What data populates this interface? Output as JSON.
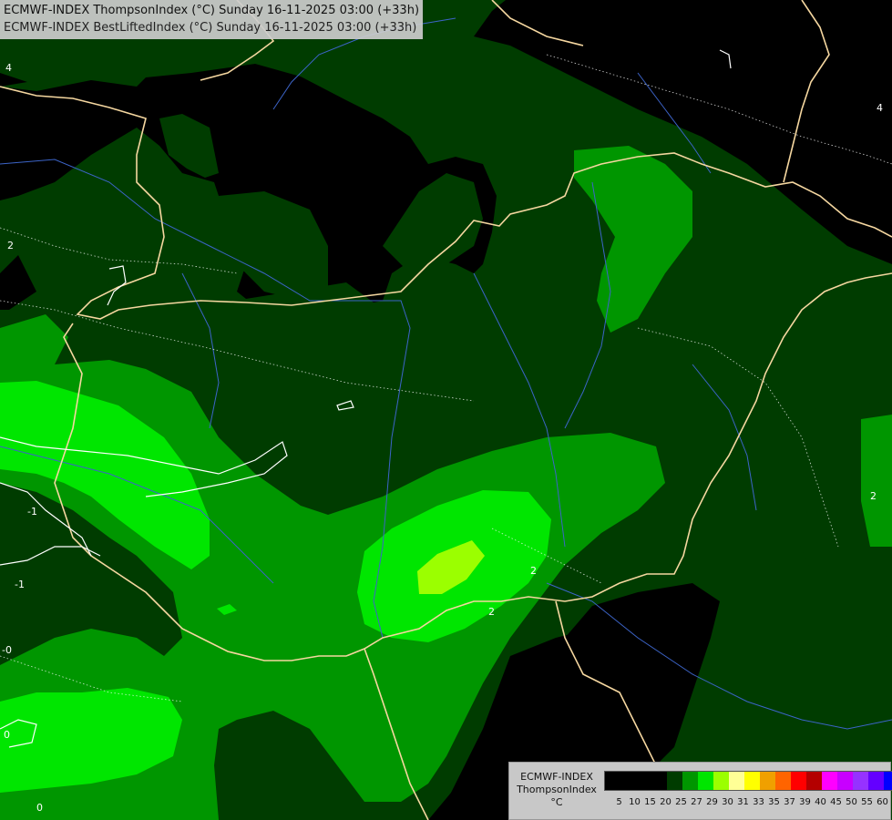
{
  "header": {
    "line1": "ECMWF-INDEX ThompsonIndex (°C) Sunday 16-11-2025 03:00 (+33h)",
    "line2": "ECMWF-INDEX BestLiftedIndex (°C) Sunday 16-11-2025 03:00 (+33h)"
  },
  "legend": {
    "line1": "ECMWF-INDEX",
    "line2": "ThompsonIndex",
    "line3": "°C",
    "colors": [
      "#000000",
      "#000000",
      "#000000",
      "#000000",
      "#003c00",
      "#009600",
      "#00e600",
      "#9bff00",
      "#ffff96",
      "#ffff00",
      "#f0a000",
      "#ff6400",
      "#ff0000",
      "#b40000",
      "#ff00ff",
      "#c800ff",
      "#9632ff",
      "#6400ff",
      "#0000ff"
    ],
    "ticks": [
      "5",
      "10",
      "15",
      "20",
      "25",
      "27",
      "29",
      "30",
      "31",
      "33",
      "35",
      "37",
      "39",
      "40",
      "45",
      "50",
      "55",
      "60"
    ]
  },
  "contour_labels": [
    "4",
    "4",
    "2",
    "2",
    "2",
    "2",
    "-1",
    "-0",
    "0",
    "0",
    "-1"
  ],
  "field_colors": {
    "below_20": "#000000",
    "band_20_25": "#003c00",
    "band_25_27": "#009600",
    "band_27_29": "#00e600",
    "band_29_30": "#9bff00",
    "borders": "#f5d7a0",
    "rivers": "#3c64c8",
    "contours": "#ffffff"
  }
}
